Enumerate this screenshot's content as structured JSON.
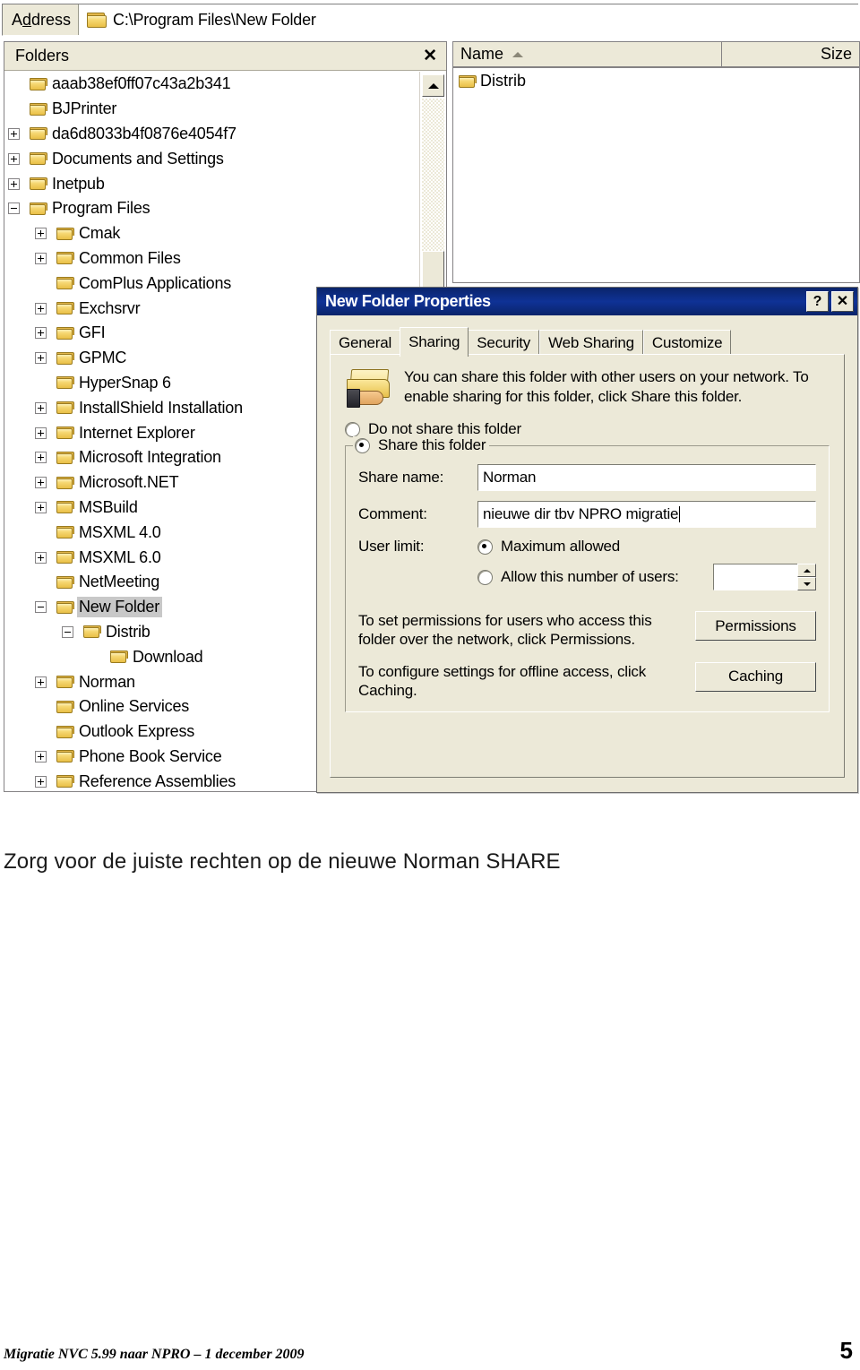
{
  "address_bar": {
    "label": "Address",
    "path": "C:\\Program Files\\New Folder",
    "icon": "folder-icon"
  },
  "folders_pane": {
    "title": "Folders",
    "close_icon": "close-icon",
    "scrollbar": {
      "up_arrow_icon": "scroll-up-arrow-icon"
    },
    "tree": [
      {
        "label": "aaab38ef0ff07c43a2b341",
        "depth": 1,
        "expander": "none",
        "selected": false
      },
      {
        "label": "BJPrinter",
        "depth": 1,
        "expander": "none",
        "selected": false
      },
      {
        "label": "da6d8033b4f0876e4054f7",
        "depth": 1,
        "expander": "plus",
        "selected": false
      },
      {
        "label": "Documents and Settings",
        "depth": 1,
        "expander": "plus",
        "selected": false
      },
      {
        "label": "Inetpub",
        "depth": 1,
        "expander": "plus",
        "selected": false
      },
      {
        "label": "Program Files",
        "depth": 1,
        "expander": "minus",
        "selected": false
      },
      {
        "label": "Cmak",
        "depth": 2,
        "expander": "plus",
        "selected": false
      },
      {
        "label": "Common Files",
        "depth": 2,
        "expander": "plus",
        "selected": false
      },
      {
        "label": "ComPlus Applications",
        "depth": 2,
        "expander": "none",
        "selected": false
      },
      {
        "label": "Exchsrvr",
        "depth": 2,
        "expander": "plus",
        "selected": false
      },
      {
        "label": "GFI",
        "depth": 2,
        "expander": "plus",
        "selected": false
      },
      {
        "label": "GPMC",
        "depth": 2,
        "expander": "plus",
        "selected": false
      },
      {
        "label": "HyperSnap 6",
        "depth": 2,
        "expander": "none",
        "selected": false
      },
      {
        "label": "InstallShield Installation",
        "depth": 2,
        "expander": "plus",
        "selected": false
      },
      {
        "label": "Internet Explorer",
        "depth": 2,
        "expander": "plus",
        "selected": false
      },
      {
        "label": "Microsoft Integration",
        "depth": 2,
        "expander": "plus",
        "selected": false
      },
      {
        "label": "Microsoft.NET",
        "depth": 2,
        "expander": "plus",
        "selected": false
      },
      {
        "label": "MSBuild",
        "depth": 2,
        "expander": "plus",
        "selected": false
      },
      {
        "label": "MSXML 4.0",
        "depth": 2,
        "expander": "none",
        "selected": false
      },
      {
        "label": "MSXML 6.0",
        "depth": 2,
        "expander": "plus",
        "selected": false
      },
      {
        "label": "NetMeeting",
        "depth": 2,
        "expander": "none",
        "selected": false
      },
      {
        "label": "New Folder",
        "depth": 2,
        "expander": "minus",
        "selected": true
      },
      {
        "label": "Distrib",
        "depth": 3,
        "expander": "minus",
        "selected": false
      },
      {
        "label": "Download",
        "depth": 4,
        "expander": "none",
        "selected": false
      },
      {
        "label": "Norman",
        "depth": 2,
        "expander": "plus",
        "selected": false
      },
      {
        "label": "Online Services",
        "depth": 2,
        "expander": "none",
        "selected": false
      },
      {
        "label": "Outlook Express",
        "depth": 2,
        "expander": "none",
        "selected": false
      },
      {
        "label": "Phone Book Service",
        "depth": 2,
        "expander": "plus",
        "selected": false
      },
      {
        "label": "Reference Assemblies",
        "depth": 2,
        "expander": "plus",
        "selected": false
      }
    ]
  },
  "list_pane": {
    "columns": [
      {
        "label": "Name",
        "sort": "asc"
      },
      {
        "label": "Size",
        "sort": "none"
      }
    ],
    "rows": [
      {
        "name": "Distrib",
        "size": ""
      }
    ]
  },
  "dialog": {
    "title": "New Folder Properties",
    "help_button": "?",
    "close_button": "✕",
    "tabs": [
      {
        "label": "General",
        "active": false
      },
      {
        "label": "Sharing",
        "active": true
      },
      {
        "label": "Security",
        "active": false
      },
      {
        "label": "Web Sharing",
        "active": false
      },
      {
        "label": "Customize",
        "active": false
      }
    ],
    "sharing": {
      "icon": "shared-folder-icon",
      "intro_text": "You can share this folder with other users on your network.  To enable sharing for this folder, click Share this folder.",
      "option_do_not_share": "Do not share this folder",
      "option_do_not_share_selected": false,
      "option_share": "Share this folder",
      "option_share_selected": true,
      "share_name_label": "Share name:",
      "share_name_value": "Norman",
      "comment_label": "Comment:",
      "comment_value": "nieuwe dir tbv NPRO migratie",
      "user_limit_label": "User limit:",
      "user_limit_max": "Maximum allowed",
      "user_limit_max_selected": true,
      "user_limit_allow": "Allow this number of users:",
      "user_limit_allow_selected": false,
      "user_limit_value": "",
      "permissions_text": "To set permissions for users who access this folder over the network, click Permissions.",
      "permissions_button": "Permissions",
      "caching_text": "To configure settings for offline access, click Caching.",
      "caching_button": "Caching"
    }
  },
  "document": {
    "caption": "Zorg voor de juiste rechten op de nieuwe Norman SHARE",
    "footer_text": "Migratie NVC 5.99 naar NPRO – 1 december 2009",
    "footer_page": "5"
  },
  "colors": {
    "dialog_title_bg": "#0a246a",
    "window_face": "#ece9d8",
    "selection": "#c8c8c8",
    "folder_yellow": "#f6d873"
  }
}
